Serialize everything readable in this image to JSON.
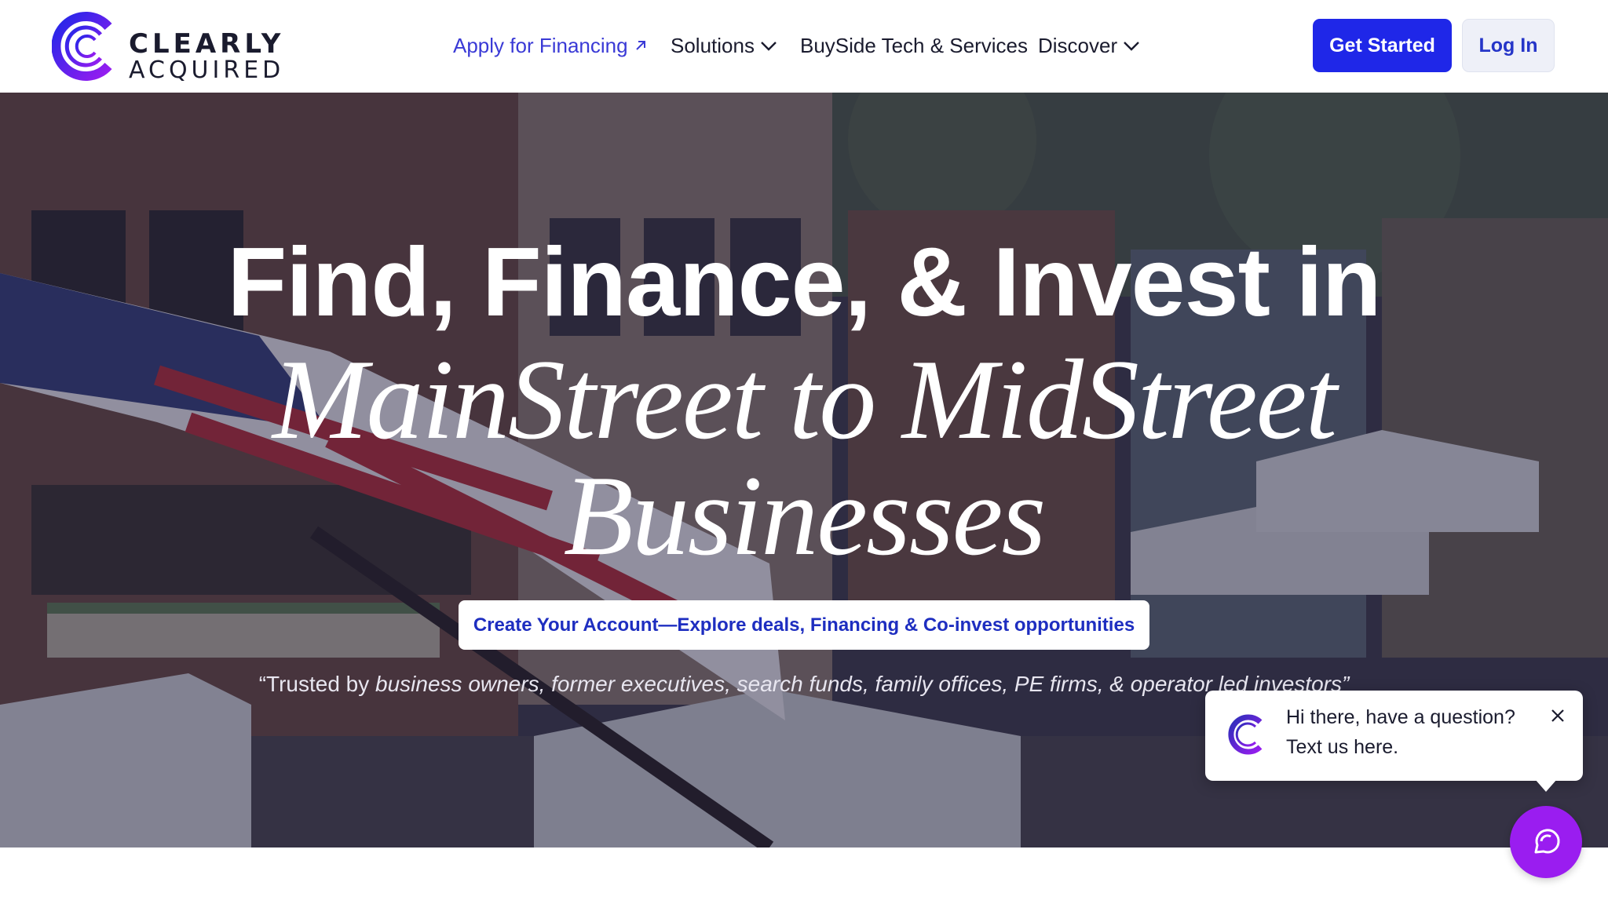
{
  "brand": {
    "word1": "CLEARLY",
    "word2": "ACQUIRED",
    "gradient_from": "#1f27e8",
    "gradient_to": "#9a1df0"
  },
  "nav": {
    "apply_label": "Apply for Financing",
    "apply_icon": "external-arrow-icon",
    "solutions_label": "Solutions",
    "buyside_label": "BuySide Tech & Services",
    "discover_label": "Discover",
    "dropdown_icon": "chevron-down-icon"
  },
  "header_actions": {
    "get_started_label": "Get Started",
    "login_label": "Log In"
  },
  "hero": {
    "headline_line1": "Find, Finance, & Invest in",
    "headline_line2": "MainStreet to MidStreet",
    "headline_line3": "Businesses",
    "cta_label": "Create Your Account—Explore deals, Financing & Co-invest opportunities",
    "trusted_lead": "“Trusted by ",
    "trusted_rest": "business owners, former executives, search funds, family offices, PE firms, & operator led investors”"
  },
  "chat": {
    "line1": "Hi there, have a question?",
    "line2": "Text us here.",
    "launcher_icon": "chat-bubble-icon",
    "close_icon": "close-icon",
    "accent": "#9a1df0"
  },
  "colors": {
    "primary_button": "#1f27e8",
    "link": "#3a3ad6",
    "chat_accent": "#9a1df0"
  }
}
